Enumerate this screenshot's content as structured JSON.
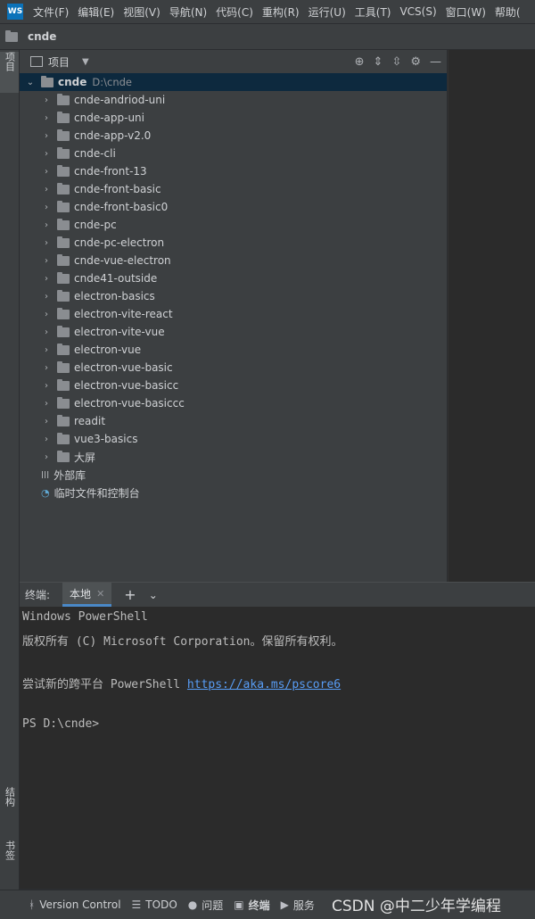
{
  "app": {
    "logo_text": "WS"
  },
  "menu": [
    "文件(F)",
    "编辑(E)",
    "视图(V)",
    "导航(N)",
    "代码(C)",
    "重构(R)",
    "运行(U)",
    "工具(T)",
    "VCS(S)",
    "窗口(W)",
    "帮助("
  ],
  "breadcrumb": {
    "label": "cnde"
  },
  "left_tabs": {
    "project": "项目",
    "structure": "结构",
    "bookmarks": "书签"
  },
  "project_panel": {
    "title": "项目",
    "root": {
      "name": "cnde",
      "path": "D:\\cnde"
    },
    "folders": [
      "cnde-andriod-uni",
      "cnde-app-uni",
      "cnde-app-v2.0",
      "cnde-cli",
      "cnde-front-13",
      "cnde-front-basic",
      "cnde-front-basic0",
      "cnde-pc",
      "cnde-pc-electron",
      "cnde-vue-electron",
      "cnde41-outside",
      "electron-basics",
      "electron-vite-react",
      "electron-vite-vue",
      "electron-vue",
      "electron-vue-basic",
      "electron-vue-basicc",
      "electron-vue-basiccc",
      "readit",
      "vue3-basics",
      "大屏"
    ],
    "external_libs": "外部库",
    "scratches": "临时文件和控制台"
  },
  "terminal": {
    "title": "终端:",
    "tab": "本地",
    "lines": {
      "l1": "Windows PowerShell",
      "l2": "版权所有 (C) Microsoft Corporation。保留所有权利。",
      "l3_prefix": "尝试新的跨平台 PowerShell ",
      "l3_link": "https://aka.ms/pscore6",
      "l4": "PS D:\\cnde>"
    }
  },
  "bottom_tabs": [
    "Version Control",
    "TODO",
    "问题",
    "终端",
    "服务"
  ],
  "watermark": "CSDN @中二少年学编程",
  "icons": {
    "sidebar_folder": "folder-icon",
    "settings": "gear-icon",
    "hide": "minus-icon",
    "locate": "crosshair-icon",
    "expand_all": "expand-all-icon",
    "collapse_all": "collapse-all-icon"
  }
}
